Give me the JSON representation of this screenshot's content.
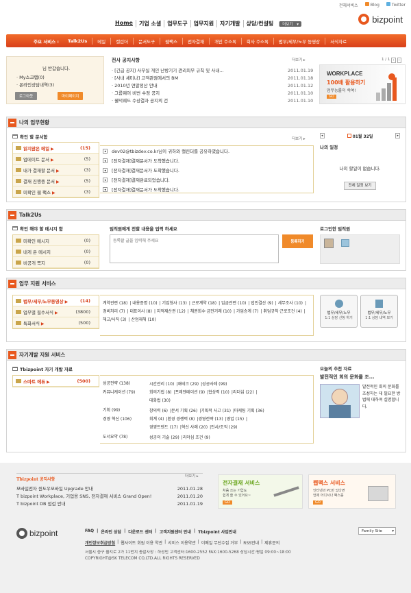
{
  "top_links": [
    "전체서비스",
    "Blog",
    "Twitter"
  ],
  "brand": "bizpoint",
  "main_menu": [
    "Home",
    "기업 소셜",
    "업무도구",
    "업무지원",
    "자기개발",
    "상담/컨설팅"
  ],
  "more_label": "더보기",
  "service_bar": {
    "label": "주요 서비스 :",
    "items": [
      "Talk2Us",
      "메일",
      "캘린더",
      "문서도구",
      "웹팩스",
      "전자결재",
      "개인 주소록",
      "회사 주소록",
      "법무/세무/노무 동영상",
      "서식자료"
    ]
  },
  "login": {
    "greeting": "님 반갑습니다.",
    "links": [
      "My스크랩(0)",
      "온라인상담내역(3)"
    ],
    "logout": "로그아웃",
    "mypage": "마이페이지"
  },
  "notice": {
    "title": "전사 공지사항",
    "more": "더보기",
    "pager": "1 / 1",
    "items": [
      {
        "t": "[긴급 공지] 사무실 개인 난방기기 관리의무 규칙 및 사내...",
        "d": "2011.01.19"
      },
      {
        "t": "[사내 세미나] 고객관점에서의 BM",
        "d": "2011.01.18"
      },
      {
        "t": "2010년 연말정산 안내",
        "d": "2011.01.12"
      },
      {
        "t": "그룹웨어 비번 수정 공지",
        "d": "2011.01.10"
      },
      {
        "t": "웰덕웨드 수상결과 공지의 건",
        "d": "2011.01.10"
      }
    ]
  },
  "banner_workplace": {
    "title": "WORKPLACE",
    "line1": "100배 활용하기",
    "line2": "업무능률이 쑥쑥!",
    "go": "GO"
  },
  "work_status": {
    "title": "나의 업무현황",
    "sub": "확인 할 문서함",
    "more": "더보기",
    "tabs": [
      {
        "l": "읽지않은 메일",
        "n": "(15)"
      },
      {
        "l": "업데이트 문서",
        "n": "(5)"
      },
      {
        "l": "내가 결재할 문서",
        "n": "(3)"
      },
      {
        "l": "결재 진행중 문서",
        "n": "(5)"
      },
      {
        "l": "미확인 웹 팩스",
        "n": "(3)"
      }
    ],
    "messages": [
      "dev02@tbizdev.co.kr님이 귀하와 캘린더를 공유하였습니다.",
      "[전자결재]결재문서가 도착했습니다.",
      "[전자결재]결재문서가 도착했습니다.",
      "[전자결재]결재완료되었습니다.",
      "[전자결재]결재문서가 도착했습니다."
    ],
    "calendar": {
      "date": "01월 32일",
      "title": "나의 일정",
      "empty": "나의 할일이 없습니다.",
      "btn": "전체 일정 보기"
    }
  },
  "talk": {
    "title": "Talk2Us",
    "sub": "확인 해야 할 메시지 함",
    "items": [
      {
        "l": "미확인 메시지",
        "n": "(0)"
      },
      {
        "l": "내게 온 메시지",
        "n": "(0)"
      },
      {
        "l": "비공개 쪽지",
        "n": "(0)"
      }
    ],
    "send_title": "임직원에게 전할 내용을 입력 하세요",
    "placeholder": "등록할 글을 입력해 주세요",
    "reg": "등록하기",
    "online_title": "로그인한 임직원"
  },
  "biz": {
    "title": "업무 지원 서비스",
    "tabs": [
      {
        "l": "법무/세무/노무동영상",
        "n": "(14)"
      },
      {
        "l": "업무별 필수서식",
        "n": "(3800)"
      },
      {
        "l": "특화서식",
        "n": "(500)"
      }
    ],
    "links": [
      "계약관련 (18)",
      "내용증명 (10)",
      "기업형사 (13)",
      "근로계약 (18)",
      "임금관련 (10)",
      "법인결산 (9)",
      "세무조사 (10)",
      "경비처리 (7)",
      "대표이사 (8)",
      "지적재산권 (12)",
      "채권회수·금전거래 (10)",
      "가업승계 (7)",
      "취업규칙·근로조건 (4)",
      "해고/사직 (3)",
      "산업재해 (10)"
    ],
    "btn1": {
      "t": "법무/세무/노무",
      "s": "1:1 상담 신청 하기"
    },
    "btn2": {
      "t": "법무/세무/노무",
      "s": "1:1 상담 내역 보기"
    }
  },
  "self": {
    "title": "자기개발 지원 서비스",
    "sub": "Tbizpoint 자기 개발 자료",
    "tab": {
      "l": "스마트 에듀",
      "n": "(500)"
    },
    "cats": [
      {
        "c": "성공전략 (138)",
        "links": [
          "시간관리 (10)",
          "재테크 (29)",
          "성공사례 (99)"
        ]
      },
      {
        "c": "커뮤니케이션 (79)",
        "links": [
          "회의기법 (8)",
          "프레젠테이션 (9)",
          "협상력 (10)",
          "리더십 (22)",
          "대화법 (30)"
        ]
      },
      {
        "c": "기획 (99)",
        "links": [
          "창의력 (6)",
          "문서 기획 (26)",
          "기획적 사고 (31)",
          "마케팅 기획 (36)"
        ]
      },
      {
        "c": "경영 혁신 (106)",
        "links": [
          "회계 (4)",
          "환경 경쟁력 (8)",
          "경영전략 (13)",
          "영업 (15)",
          "경영트렌드 (17)",
          "혁신 사례 (20)",
          "인사/조직 (29)"
        ]
      },
      {
        "c": "도서요약 (78)",
        "links": [
          "성공의 기술 (29)",
          "리더십 조건 (9)"
        ]
      }
    ],
    "reco": {
      "title": "오늘의 추천 자료",
      "head": "발전적인 회의 문화를 조...",
      "body": "발전적인 회의 문화를 조성하는 데 필요한 방법에 대하여 설명합니다."
    }
  },
  "footer_notice": {
    "title": "Tbizpoint 공지사항",
    "more": "더보기",
    "items": [
      {
        "t": "모바일전자 윈도우모바일 Upgrade 안내",
        "d": "2011.01.28"
      },
      {
        "t": "T bizpoint Workplace, 기업용 SNS, 전자결재 서비스 Grand Open!",
        "d": "2011.01.20"
      },
      {
        "t": "T bizpoint DB 점검 안내",
        "d": "2011.01.19"
      }
    ]
  },
  "ban_approval": {
    "title": "전자결재 서비스",
    "s1": "처음 쓰는 기업도",
    "s2": "쉽게 쓸 수 있어요~",
    "go": "GO"
  },
  "ban_fax": {
    "title": "웹팩스 서비스",
    "s1": "인터넷과 PC만 있다면",
    "s2": "언제 어디서나 팩스를",
    "go": "GO"
  },
  "bottom": {
    "links1": [
      "FAQ",
      "온라인 상담",
      "다운로드 센터",
      "고객지원센터 안내",
      "Tbizpoint 사업안내"
    ],
    "links2": [
      "개인정보취급방침",
      "웹사이트 회원 이용 약관",
      "서비스 이용약관",
      "이메일 무단수집 거부",
      "RSS안내",
      "제휴문의"
    ],
    "addr": "서울시 중구 을지로 2가 11번지 총괄사장 : 하성민 고객센터:1600-2552 FAX:1600-5268 상담시간:평일 09:00~18:00",
    "copy": "COPYRIGHT@SK TELECOM CO,LTD.ALL RIGHTS RESERVED",
    "family": "Family Site"
  },
  "colors": {
    "accent": "#e8581e",
    "bar_top": "#f26b2a",
    "bar_bottom": "#d8401a",
    "tab_border": "#e2cf94"
  }
}
